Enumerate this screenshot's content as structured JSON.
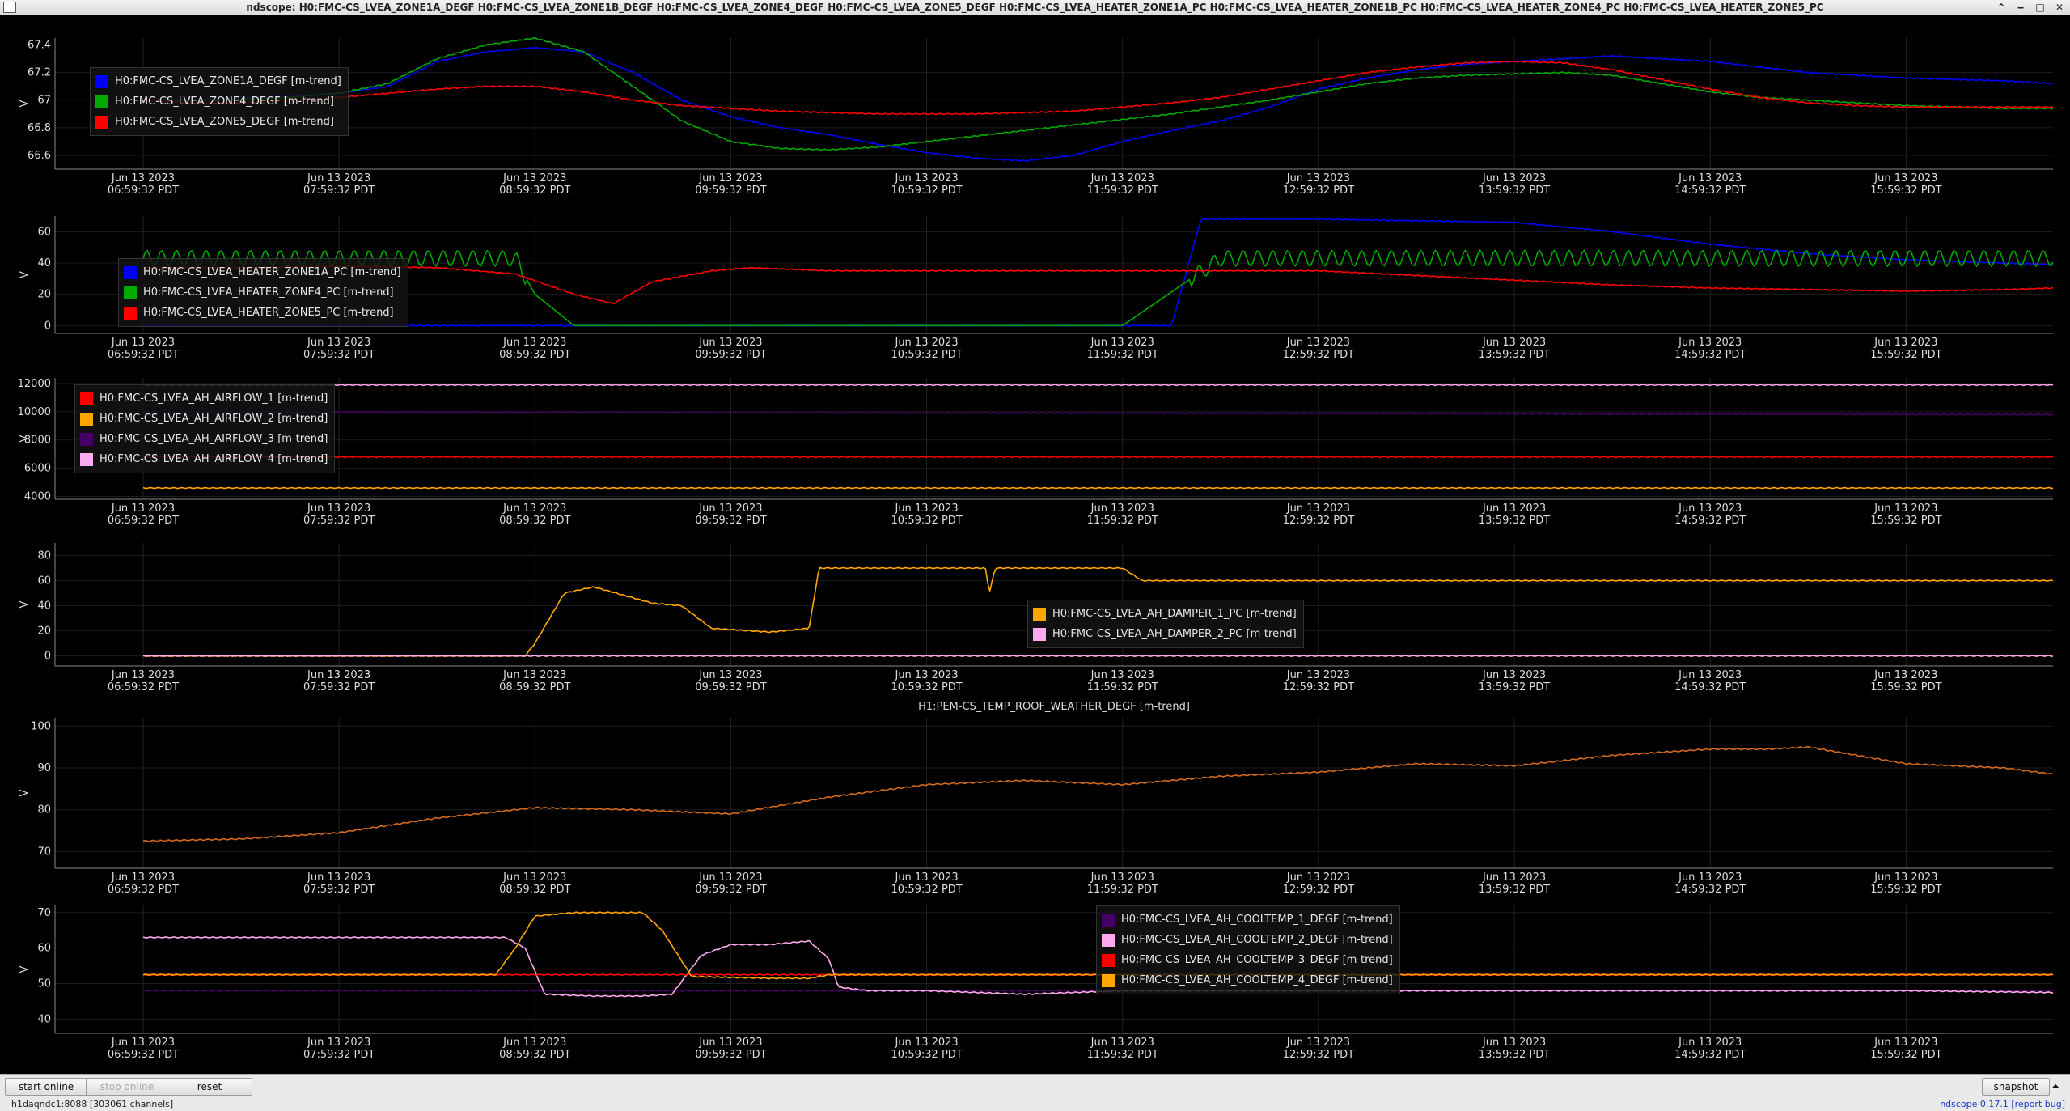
{
  "window": {
    "title": "ndscope: H0:FMC-CS_LVEA_ZONE1A_DEGF H0:FMC-CS_LVEA_ZONE1B_DEGF H0:FMC-CS_LVEA_ZONE4_DEGF H0:FMC-CS_LVEA_ZONE5_DEGF H0:FMC-CS_LVEA_HEATER_ZONE1A_PC H0:FMC-CS_LVEA_HEATER_ZONE1B_PC H0:FMC-CS_LVEA_HEATER_ZONE4_PC H0:FMC-CS_LVEA_HEATER_ZONE5_PC",
    "controls": [
      "⌃",
      "‒",
      "□",
      "✕"
    ]
  },
  "x_ticks": {
    "date": "Jun 13 2023",
    "times": [
      "06:59:32 PDT",
      "07:59:32 PDT",
      "08:59:32 PDT",
      "09:59:32 PDT",
      "10:59:32 PDT",
      "11:59:32 PDT",
      "12:59:32 PDT",
      "13:59:32 PDT",
      "14:59:32 PDT",
      "15:59:32 PDT"
    ]
  },
  "colors": {
    "blue": "#0000ff",
    "green": "#00aa00",
    "red": "#ff0000",
    "orange": "#ffa500",
    "purple": "#440066",
    "pink": "#ffaaee",
    "weather": "#d2691e"
  },
  "chart_data": [
    {
      "type": "line",
      "ylabel": "V",
      "ylim": [
        66.5,
        67.45
      ],
      "yticks": [
        66.6,
        66.8,
        67,
        67.2,
        67.4
      ],
      "legend_position": "top-left",
      "series": [
        {
          "name": "H0:FMC-CS_LVEA_ZONE1A_DEGF [m-trend]",
          "color": "blue",
          "x": [
            0,
            0.25,
            0.5,
            0.75,
            1,
            1.25,
            1.5,
            1.75,
            2,
            2.25,
            2.5,
            2.75,
            3,
            3.25,
            3.5,
            3.75,
            4,
            4.25,
            4.5,
            4.75,
            5,
            5.25,
            5.5,
            5.75,
            6,
            6.25,
            6.5,
            6.75,
            7,
            7.25,
            7.5,
            7.75,
            8,
            8.25,
            8.5,
            8.75,
            9,
            9.25,
            9.5,
            9.75
          ],
          "y": [
            67.0,
            67.0,
            67.02,
            67.03,
            67.05,
            67.1,
            67.28,
            67.35,
            67.38,
            67.35,
            67.2,
            67.0,
            66.88,
            66.8,
            66.75,
            66.68,
            66.62,
            66.58,
            66.56,
            66.6,
            66.7,
            66.78,
            66.85,
            66.95,
            67.08,
            67.16,
            67.22,
            67.26,
            67.28,
            67.3,
            67.32,
            67.3,
            67.28,
            67.24,
            67.2,
            67.18,
            67.16,
            67.15,
            67.14,
            67.12
          ]
        },
        {
          "name": "H0:FMC-CS_LVEA_ZONE4_DEGF [m-trend]",
          "color": "green",
          "x": [
            0,
            0.25,
            0.5,
            0.75,
            1,
            1.25,
            1.5,
            1.75,
            2,
            2.25,
            2.5,
            2.75,
            3,
            3.25,
            3.5,
            3.75,
            4,
            4.25,
            4.5,
            4.75,
            5,
            5.25,
            5.5,
            5.75,
            6,
            6.25,
            6.5,
            6.75,
            7,
            7.25,
            7.5,
            7.75,
            8,
            8.25,
            8.5,
            8.75,
            9,
            9.25,
            9.5,
            9.75
          ],
          "y": [
            67.0,
            67.0,
            67.01,
            67.02,
            67.05,
            67.12,
            67.3,
            67.4,
            67.45,
            67.35,
            67.1,
            66.85,
            66.7,
            66.65,
            66.64,
            66.66,
            66.7,
            66.74,
            66.78,
            66.82,
            66.86,
            66.9,
            66.95,
            67.0,
            67.06,
            67.12,
            67.16,
            67.18,
            67.19,
            67.2,
            67.18,
            67.12,
            67.06,
            67.02,
            67.0,
            66.98,
            66.96,
            66.95,
            66.94,
            66.94
          ]
        },
        {
          "name": "H0:FMC-CS_LVEA_ZONE5_DEGF [m-trend]",
          "color": "red",
          "x": [
            0,
            0.25,
            0.5,
            0.75,
            1,
            1.25,
            1.5,
            1.75,
            2,
            2.25,
            2.5,
            2.75,
            3,
            3.25,
            3.5,
            3.75,
            4,
            4.25,
            4.5,
            4.75,
            5,
            5.25,
            5.5,
            5.75,
            6,
            6.25,
            6.5,
            6.75,
            7,
            7.25,
            7.5,
            7.75,
            8,
            8.25,
            8.5,
            8.75,
            9,
            9.25,
            9.5,
            9.75
          ],
          "y": [
            67.0,
            66.98,
            66.98,
            67.0,
            67.02,
            67.05,
            67.08,
            67.1,
            67.1,
            67.06,
            67.0,
            66.96,
            66.94,
            66.92,
            66.91,
            66.9,
            66.9,
            66.9,
            66.91,
            66.92,
            66.95,
            66.98,
            67.02,
            67.08,
            67.14,
            67.2,
            67.24,
            67.27,
            67.28,
            67.27,
            67.22,
            67.15,
            67.08,
            67.02,
            66.98,
            66.96,
            66.95,
            66.95,
            66.95,
            66.95
          ]
        }
      ]
    },
    {
      "type": "line",
      "ylabel": "V",
      "ylim": [
        -5,
        70
      ],
      "yticks": [
        0,
        20,
        40,
        60
      ],
      "legend_position": "bottom-left",
      "series": [
        {
          "name": "H0:FMC-CS_LVEA_HEATER_ZONE1A_PC [m-trend]",
          "color": "blue",
          "x": [
            0,
            5.1,
            5.25,
            5.4,
            6,
            7,
            7.5,
            8,
            8.5,
            9,
            9.5,
            9.75
          ],
          "y": [
            0,
            0,
            0,
            68,
            68,
            66,
            60,
            52,
            46,
            42,
            40,
            39
          ]
        },
        {
          "name": "H0:FMC-CS_LVEA_HEATER_ZONE4_PC [m-trend]",
          "color": "green",
          "x": [
            0,
            0.5,
            1,
            1.5,
            1.9,
            2.0,
            2.2,
            2.5,
            2.7,
            2.9,
            3.0,
            3.1,
            3.5,
            4,
            4.5,
            5,
            5.5,
            6,
            6.5,
            7,
            7.5,
            8,
            8.5,
            9,
            9.5,
            9.75
          ],
          "y": [
            43,
            43,
            43,
            43,
            43,
            20,
            0,
            0,
            0,
            0,
            0,
            0,
            0,
            0,
            0,
            0,
            43,
            43,
            43,
            43,
            43,
            43,
            43,
            43,
            43,
            43
          ],
          "note": "oscillating ±5 around 43 while active"
        },
        {
          "name": "H0:FMC-CS_LVEA_HEATER_ZONE5_PC [m-trend]",
          "color": "red",
          "x": [
            0,
            0.5,
            1,
            1.5,
            1.9,
            2.2,
            2.4,
            2.6,
            2.9,
            3.1,
            3.3,
            3.5,
            4,
            4.5,
            5,
            5.5,
            6,
            6.5,
            7,
            7.5,
            8,
            8.5,
            9,
            9.5,
            9.75
          ],
          "y": [
            37,
            37,
            38,
            37,
            33,
            20,
            14,
            28,
            35,
            37,
            36,
            35,
            35,
            35,
            35,
            35,
            35,
            32,
            29,
            26,
            24,
            23,
            22,
            23,
            24
          ]
        }
      ]
    },
    {
      "type": "line",
      "ylabel": "V",
      "ylim": [
        3800,
        12400
      ],
      "yticks": [
        4000,
        6000,
        8000,
        10000,
        12000
      ],
      "legend_position": "top-left",
      "series": [
        {
          "name": "H0:FMC-CS_LVEA_AH_AIRFLOW_1 [m-trend]",
          "color": "red",
          "x": [
            0,
            9.75
          ],
          "y": [
            6800,
            6800
          ]
        },
        {
          "name": "H0:FMC-CS_LVEA_AH_AIRFLOW_2 [m-trend]",
          "color": "orange",
          "x": [
            0,
            9.75
          ],
          "y": [
            4600,
            4600
          ]
        },
        {
          "name": "H0:FMC-CS_LVEA_AH_AIRFLOW_3 [m-trend]",
          "color": "purple",
          "x": [
            0,
            9.75
          ],
          "y": [
            10000,
            9800
          ]
        },
        {
          "name": "H0:FMC-CS_LVEA_AH_AIRFLOW_4 [m-trend]",
          "color": "pink",
          "x": [
            0,
            9.75
          ],
          "y": [
            11900,
            11900
          ]
        }
      ]
    },
    {
      "type": "line",
      "ylabel": "V",
      "ylim": [
        -8,
        90
      ],
      "yticks": [
        0,
        20,
        40,
        60,
        80
      ],
      "legend_position": "center-right",
      "series": [
        {
          "name": "H0:FMC-CS_LVEA_AH_DAMPER_1_PC [m-trend]",
          "color": "orange",
          "x": [
            0,
            1.5,
            1.95,
            2.0,
            2.15,
            2.3,
            2.6,
            2.75,
            2.9,
            3.2,
            3.4,
            3.45,
            3.6,
            4.0,
            4.3,
            4.32,
            4.35,
            4.4,
            4.8,
            5.0,
            5.1,
            6,
            7,
            8,
            9,
            9.75
          ],
          "y": [
            0,
            0,
            0,
            10,
            50,
            55,
            42,
            40,
            22,
            19,
            22,
            70,
            70,
            70,
            70,
            50,
            70,
            70,
            70,
            70,
            60,
            60,
            60,
            60,
            60,
            60
          ]
        },
        {
          "name": "H0:FMC-CS_LVEA_AH_DAMPER_2_PC [m-trend]",
          "color": "pink",
          "x": [
            0,
            9.75
          ],
          "y": [
            0,
            0
          ]
        }
      ]
    },
    {
      "type": "line",
      "title": "H1:PEM-CS_TEMP_ROOF_WEATHER_DEGF [m-trend]",
      "ylabel": "V",
      "ylim": [
        66,
        102
      ],
      "yticks": [
        70,
        80,
        90,
        100
      ],
      "series": [
        {
          "name": "H1:PEM-CS_TEMP_ROOF_WEATHER_DEGF [m-trend]",
          "color": "weather",
          "x": [
            0,
            0.5,
            1,
            1.5,
            2,
            2.5,
            3,
            3.5,
            4,
            4.5,
            5,
            5.5,
            6,
            6.5,
            7,
            7.5,
            8,
            8.3,
            8.5,
            9,
            9.5,
            9.75
          ],
          "y": [
            72.5,
            73,
            74.5,
            78,
            80.5,
            80,
            79,
            83,
            86,
            87,
            86,
            88,
            89,
            91,
            90.5,
            93,
            94.5,
            94.5,
            95,
            91,
            90,
            88.5
          ]
        }
      ]
    },
    {
      "type": "line",
      "ylabel": "V",
      "ylim": [
        36,
        72
      ],
      "yticks": [
        40,
        50,
        60,
        70
      ],
      "legend_position": "top-right",
      "series": [
        {
          "name": "H0:FMC-CS_LVEA_AH_COOLTEMP_1_DEGF [m-trend]",
          "color": "purple",
          "x": [
            0,
            9.75
          ],
          "y": [
            48,
            48
          ]
        },
        {
          "name": "H0:FMC-CS_LVEA_AH_COOLTEMP_2_DEGF [m-trend]",
          "color": "pink",
          "x": [
            0,
            0.5,
            1,
            1.5,
            1.85,
            1.95,
            2.05,
            2.3,
            2.55,
            2.7,
            2.85,
            3.0,
            3.2,
            3.4,
            3.5,
            3.55,
            3.7,
            4,
            4.5,
            5,
            6,
            7,
            8,
            9,
            9.75
          ],
          "y": [
            63,
            63,
            63,
            63,
            63,
            60,
            47,
            46.5,
            46.5,
            47,
            58,
            61,
            61,
            62,
            57,
            49,
            48,
            48,
            47,
            48,
            48,
            48,
            48,
            48,
            47.5
          ]
        },
        {
          "name": "H0:FMC-CS_LVEA_AH_COOLTEMP_3_DEGF [m-trend]",
          "color": "red",
          "x": [
            0,
            9.75
          ],
          "y": [
            52.5,
            52.5
          ]
        },
        {
          "name": "H0:FMC-CS_LVEA_AH_COOLTEMP_4_DEGF [m-trend]",
          "color": "orange",
          "x": [
            0,
            0.5,
            1,
            1.5,
            1.8,
            1.9,
            2.0,
            2.2,
            2.55,
            2.65,
            2.8,
            3.2,
            3.4,
            3.5,
            4,
            5,
            6,
            7,
            8,
            9,
            9.75
          ],
          "y": [
            52.5,
            52.5,
            52.5,
            52.5,
            52.5,
            60,
            69,
            70,
            70,
            65,
            52,
            51.5,
            51.5,
            52.5,
            52.5,
            52.5,
            52.5,
            52.5,
            52.5,
            52.5,
            52.5
          ]
        }
      ]
    }
  ],
  "bottom": {
    "start_online": "start online",
    "stop_online": "stop online",
    "reset": "reset",
    "snapshot": "snapshot",
    "collapse": "⏶",
    "status": "h1daqndc1:8088  [303061 channels]",
    "version": "ndscope 0.17.1 [report bug]"
  }
}
